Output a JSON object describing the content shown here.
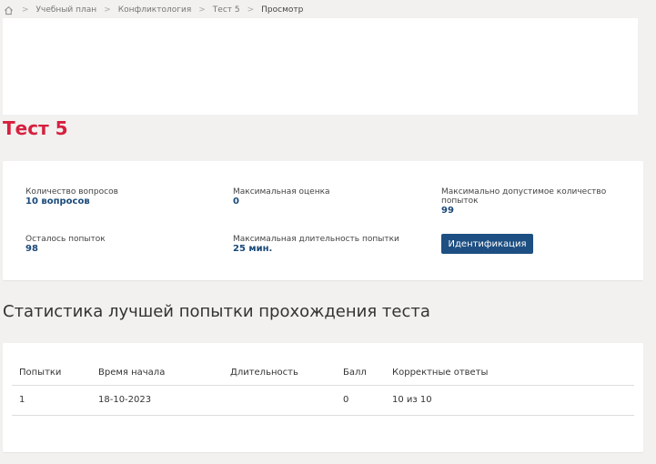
{
  "breadcrumb": {
    "home_icon": "home-icon",
    "items": [
      "Учебный план",
      "Конфликтология",
      "Тест 5"
    ],
    "current": "Просмотр"
  },
  "test": {
    "title": "Тест 5"
  },
  "info": {
    "questions_label": "Количество вопросов",
    "questions_value": "10 вопросов",
    "max_score_label": "Максимальная оценка",
    "max_score_value": "0",
    "max_attempts_label": "Максимально допустимое количество попыток",
    "max_attempts_value": "99",
    "attempts_left_label": "Осталось попыток",
    "attempts_left_value": "98",
    "max_duration_label": "Максимальная длительность попытки",
    "max_duration_value": "25 мин.",
    "identify_button": "Идентификация"
  },
  "stats": {
    "title": "Статистика лучшей попытки прохождения теста",
    "columns": [
      "Попытки",
      "Время начала",
      "Длительность",
      "Балл",
      "Корректные ответы"
    ],
    "rows": [
      [
        "1",
        "18-10-2023",
        "",
        "0",
        "10 из 10"
      ]
    ]
  },
  "colors": {
    "title_accent": "#d6203f",
    "button": "#1e4f82",
    "value_text": "#1a4a7a"
  }
}
